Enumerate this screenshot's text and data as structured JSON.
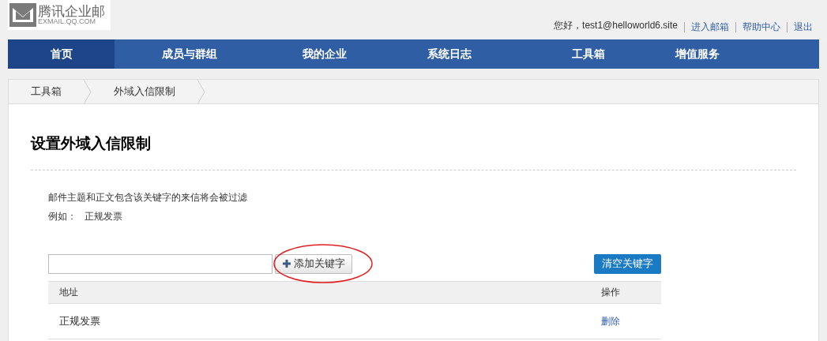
{
  "logo": {
    "name": "腾讯企业邮",
    "domain": "EXMAIL.QQ.COM"
  },
  "user_bar": {
    "greeting": "您好，test1@helloworld6.site",
    "links": [
      "进入邮箱",
      "帮助中心",
      "退出"
    ]
  },
  "nav": [
    {
      "label": "首页",
      "selected": true
    },
    {
      "label": "成员与群组",
      "selected": false
    },
    {
      "label": "我的企业",
      "selected": false
    },
    {
      "label": "系统日志",
      "selected": false
    },
    {
      "label": "工具箱",
      "selected": false
    },
    {
      "label": "增值服务",
      "selected": false
    }
  ],
  "breadcrumb": [
    "工具箱",
    "外域入信限制"
  ],
  "page": {
    "title": "设置外域入信限制",
    "description": "邮件主题和正文包含该关键字的来信将会被过滤",
    "example_label": "例如：",
    "example_value": "正规发票"
  },
  "add_button": "添加关键字",
  "clear_button": "清空关键字",
  "table": {
    "columns": [
      "地址",
      "操作"
    ],
    "rows": [
      {
        "address": "正规发票",
        "action": "删除"
      }
    ]
  }
}
